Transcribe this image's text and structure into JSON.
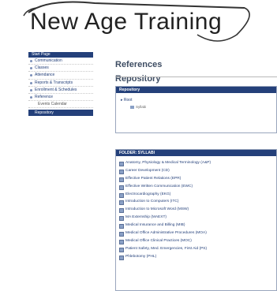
{
  "site": {
    "title": "New Age Training"
  },
  "sidebar": {
    "start_label": "Start Page",
    "items": [
      {
        "label": "Communication"
      },
      {
        "label": "Classes"
      },
      {
        "label": "Attendance"
      },
      {
        "label": "Reports & Transcripts"
      },
      {
        "label": "Enrollment & Schedules"
      },
      {
        "label": "Reference"
      },
      {
        "label": "Events Calendar"
      },
      {
        "label": "Repository"
      }
    ]
  },
  "main": {
    "references_title": "References",
    "repository_title": "Repository",
    "panel1": {
      "header": "Repository",
      "root_label": "Root",
      "child_label": "Syllabi"
    },
    "panel2": {
      "header": "FOLDER: SYLLABI",
      "files": [
        "Anatomy, Physiology & Medical Terminology (A&P)",
        "Career Development (CD)",
        "Effective Patient Relations (EPR)",
        "Effective Written Communication (EWC)",
        "Electrocardiography (EKG)",
        "Introduction to Computers (ITC)",
        "Introduction to Microsoft Word (MSW)",
        "MA Externship (MAEXT)",
        "Medical Insurance and Billing (MIB)",
        "Medical Office Administrative Procedures (MOA)",
        "Medical Office Clinical Practices (MOC)",
        "Patient Safety, Med. Emergencies, First Aid (PS)",
        "Phlebotomy (PHL)"
      ]
    }
  },
  "colors": {
    "accent": "#24407a",
    "heading": "#3e4d63"
  },
  "icons": {
    "tree_root": "caret-icon",
    "tree_child": "folder-icon",
    "file": "document-icon"
  }
}
